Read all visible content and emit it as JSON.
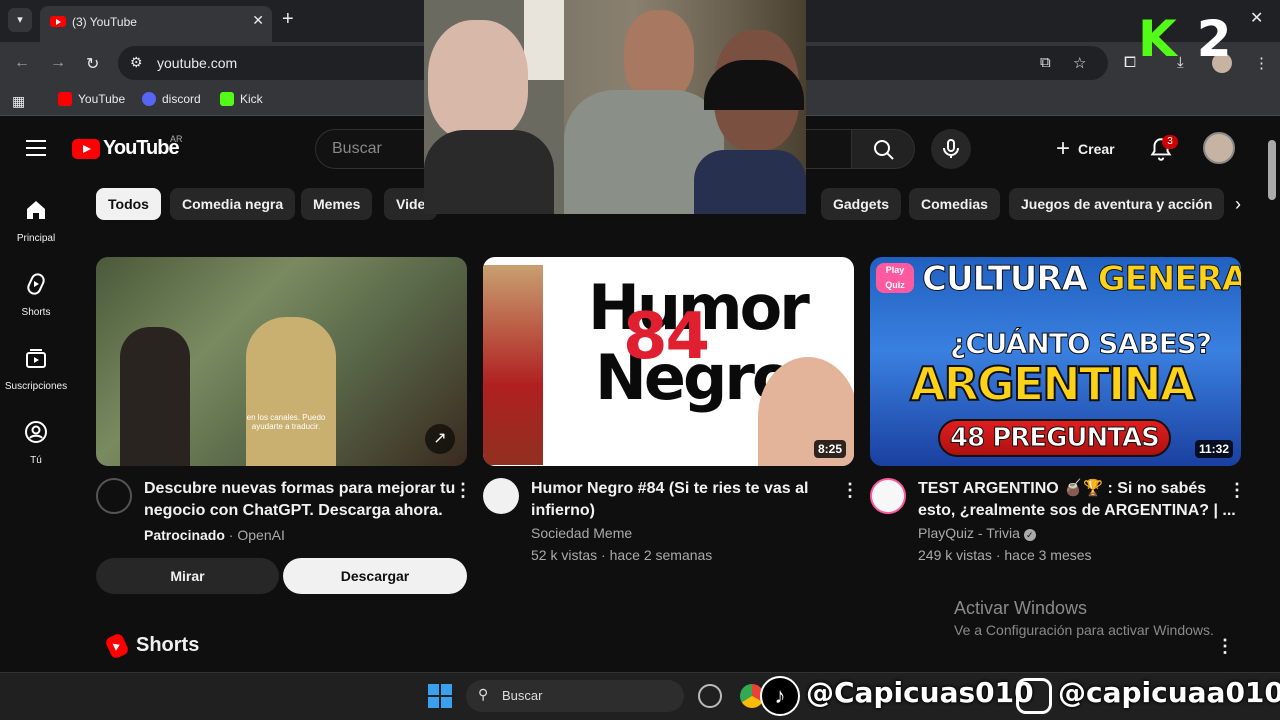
{
  "browser": {
    "tab_title": "(3) YouTube",
    "url": "youtube.com",
    "bookmarks": [
      {
        "label": "YouTube",
        "icon": "youtube-icon",
        "color": "#ff0000"
      },
      {
        "label": "discord",
        "icon": "discord-icon",
        "color": "#5865f2"
      },
      {
        "label": "Kick",
        "icon": "kick-icon",
        "color": "#53fc18"
      }
    ]
  },
  "youtube": {
    "country": "AR",
    "logo_text": "YouTube",
    "search_placeholder": "Buscar",
    "create_label": "Crear",
    "notification_count": "3",
    "sidebar": [
      {
        "label": "Principal",
        "icon": "home-icon"
      },
      {
        "label": "Shorts",
        "icon": "shorts-icon"
      },
      {
        "label": "Suscripciones",
        "icon": "subscriptions-icon"
      },
      {
        "label": "Tú",
        "icon": "you-icon"
      }
    ],
    "chips": [
      "Todos",
      "Comedia negra",
      "Memes",
      "Vide",
      "Gadgets",
      "Comedias",
      "Juegos de aventura y acción"
    ],
    "videos": [
      {
        "title_line1": "Descubre nuevas formas para mejorar tu",
        "title_line2": "negocio con ChatGPT. Descarga ahora.",
        "sponsored": "Patrocinado",
        "channel": "OpenAI",
        "thumb_caption": "en los canales. Puedo ayudarte a traducir.",
        "btn_watch": "Mirar",
        "btn_download": "Descargar"
      },
      {
        "title_line1": "Humor Negro #84 (Si te ries te vas al",
        "title_line2": "infierno)",
        "channel": "Sociedad Meme",
        "meta": "52 k vistas · hace 2 semanas",
        "duration": "8:25",
        "thumb_word1": "Humor",
        "thumb_word2": "Negro",
        "thumb_number": "84"
      },
      {
        "title_line1": "TEST ARGENTINO 🧉🏆 : Si no sabés",
        "title_line2": "esto, ¿realmente sos de ARGENTINA? | ...",
        "channel": "PlayQuiz - Trivia",
        "meta": "249 k vistas · hace 3 meses",
        "duration": "11:32",
        "thumb_line1a": "CULTURA",
        "thumb_line1b": "GENERAL",
        "thumb_line2": "¿CUÁNTO SABES?",
        "thumb_line3": "ARGENTINA",
        "thumb_line4": "48 PREGUNTAS",
        "badge": "Play Quiz"
      }
    ],
    "shorts_heading": "Shorts"
  },
  "overlay": {
    "k2_k": "K",
    "k2_2": "2",
    "tiktok": "@Capicuas010",
    "instagram": "@capicuaa010"
  },
  "windows": {
    "activate_title": "Activar Windows",
    "activate_sub": "Ve a Configuración para activar Windows.",
    "taskbar_search": "Buscar"
  }
}
